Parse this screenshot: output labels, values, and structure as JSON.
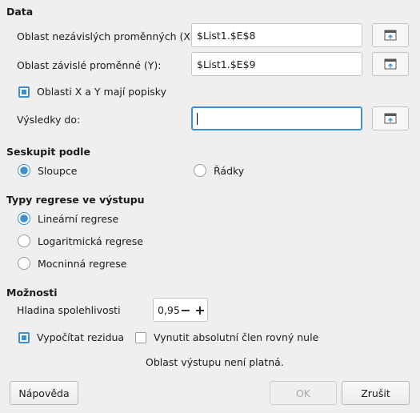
{
  "data_section": {
    "title": "Data",
    "x_range_label": "Oblast nezávislých proměnných (X):",
    "x_range_value": "$List1.$E$8",
    "y_range_label": "Oblast závislé proměnné (Y):",
    "y_range_value": "$List1.$E$9",
    "labels_checkbox": {
      "label": "Oblasti X a Y mají popisky",
      "checked": true
    },
    "results_label": "Výsledky do:",
    "results_value": ""
  },
  "group_section": {
    "title": "Seskupit podle",
    "options": [
      {
        "label": "Sloupce",
        "selected": true
      },
      {
        "label": "Řádky",
        "selected": false
      }
    ]
  },
  "regression_section": {
    "title": "Typy regrese ve výstupu",
    "options": [
      {
        "label": "Lineární regrese",
        "selected": true
      },
      {
        "label": "Logaritmická regrese",
        "selected": false
      },
      {
        "label": "Mocninná regrese",
        "selected": false
      }
    ]
  },
  "options_section": {
    "title": "Možnosti",
    "confidence_label": "Hladina spolehlivosti",
    "confidence_value": "0,95",
    "minus": "−",
    "plus": "+",
    "residuals": {
      "label": "Vypočítat rezidua",
      "checked": true
    },
    "zero_intercept": {
      "label": "Vynutit absolutní člen rovný nule",
      "checked": false
    }
  },
  "status_message": "Oblast výstupu není platná.",
  "buttons": {
    "help": "Nápověda",
    "ok": "OK",
    "cancel": "Zrušit"
  },
  "icons": {
    "shrink": "shrink-range-icon"
  }
}
